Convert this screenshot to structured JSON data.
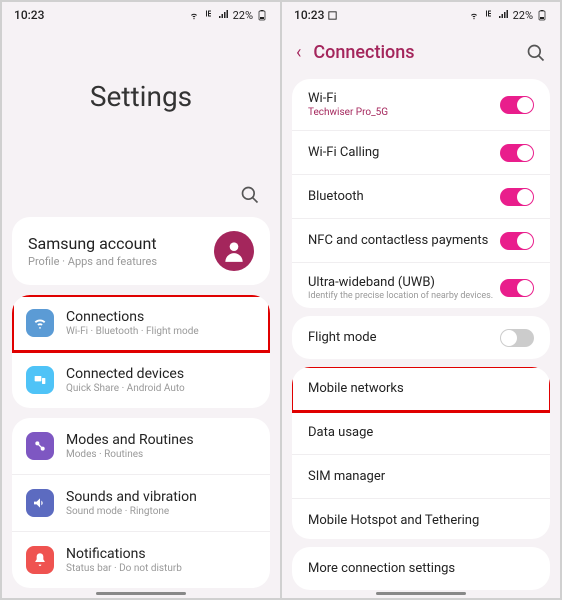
{
  "status": {
    "time": "10:23",
    "battery": "22%"
  },
  "left": {
    "title": "Settings",
    "account": {
      "title": "Samsung account",
      "sub": "Profile · Apps and features"
    },
    "group1": [
      {
        "title": "Connections",
        "sub": "Wi-Fi · Bluetooth · Flight mode"
      },
      {
        "title": "Connected devices",
        "sub": "Quick Share · Android Auto"
      }
    ],
    "group2": [
      {
        "title": "Modes and Routines",
        "sub": "Modes · Routines"
      },
      {
        "title": "Sounds and vibration",
        "sub": "Sound mode · Ringtone"
      },
      {
        "title": "Notifications",
        "sub": "Status bar · Do not disturb"
      }
    ]
  },
  "right": {
    "header": "Connections",
    "g1": [
      {
        "label": "Wi-Fi",
        "sub": "Techwiser Pro_5G",
        "on": true
      },
      {
        "label": "Wi-Fi Calling",
        "on": true
      },
      {
        "label": "Bluetooth",
        "on": true
      },
      {
        "label": "NFC and contactless payments",
        "on": true
      },
      {
        "label": "Ultra-wideband (UWB)",
        "sub_gray": "Identify the precise location of nearby devices.",
        "on": true
      }
    ],
    "g2": [
      {
        "label": "Flight mode",
        "on": false
      }
    ],
    "g3": [
      {
        "label": "Mobile networks"
      },
      {
        "label": "Data usage"
      },
      {
        "label": "SIM manager"
      },
      {
        "label": "Mobile Hotspot and Tethering"
      }
    ],
    "g4": [
      {
        "label": "More connection settings"
      }
    ]
  }
}
